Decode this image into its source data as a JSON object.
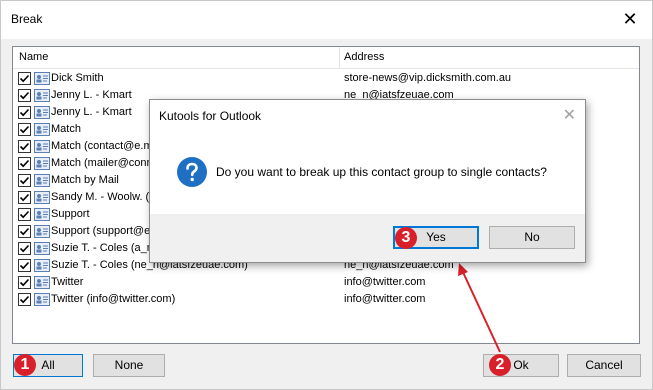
{
  "window": {
    "title": "Break"
  },
  "list": {
    "columns": {
      "name": "Name",
      "address": "Address"
    },
    "rows": [
      {
        "name": "Dick Smith",
        "address": "store-news@vip.dicksmith.com.au"
      },
      {
        "name": "Jenny L. - Kmart",
        "address": "ne_n@iatsfzeuae.com"
      },
      {
        "name": "Jenny L. - Kmart",
        "address": ""
      },
      {
        "name": "Match",
        "address": ""
      },
      {
        "name": "Match (contact@e.m",
        "address": ""
      },
      {
        "name": "Match (mailer@conne",
        "address": ""
      },
      {
        "name": "Match by Mail",
        "address": ""
      },
      {
        "name": "Sandy M. - Woolw. (",
        "address": ""
      },
      {
        "name": "Support",
        "address": ""
      },
      {
        "name": "Support (support@e",
        "address": ""
      },
      {
        "name": "Suzie T. - Coles (a_m",
        "address": ""
      },
      {
        "name": "Suzie T. - Coles (ne_n@iatsfzeuae.com)",
        "address": "ne_n@iatsfzeuae.com"
      },
      {
        "name": "Twitter",
        "address": "info@twitter.com"
      },
      {
        "name": "Twitter (info@twitter.com)",
        "address": "info@twitter.com"
      }
    ]
  },
  "buttons": {
    "all": "All",
    "none": "None",
    "ok": "Ok",
    "cancel": "Cancel"
  },
  "dialog": {
    "title": "Kutools for Outlook",
    "message": "Do you want to break up this contact group to single contacts?",
    "yes": "Yes",
    "no": "No"
  },
  "badges": {
    "b1": "1",
    "b2": "2",
    "b3": "3"
  },
  "colors": {
    "badge": "#d9202a",
    "accent": "#0078d7",
    "question_icon": "#1f6fc5"
  },
  "icons": {
    "contact_card": "contact-card-icon",
    "question": "question-icon",
    "close": "close-icon",
    "checkbox": "checkmark-icon"
  }
}
